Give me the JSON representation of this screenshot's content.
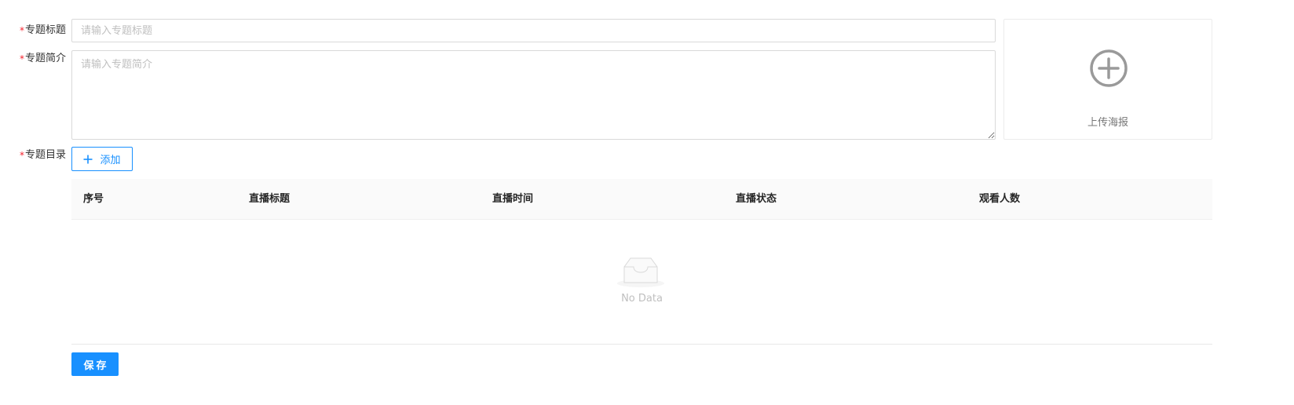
{
  "form": {
    "required_mark": "*",
    "title_label": "专题标题",
    "title_placeholder": "请输入专题标题",
    "title_value": "",
    "desc_label": "专题简介",
    "desc_placeholder": "请输入专题简介",
    "desc_value": "",
    "catalog_label": "专题目录",
    "add_label": "添加",
    "save_label": "保存"
  },
  "poster": {
    "upload_label": "上传海报",
    "icon": "plus-circle-icon"
  },
  "table": {
    "columns": [
      "序号",
      "直播标题",
      "直播时间",
      "直播状态",
      "观看人数"
    ],
    "rows": [],
    "empty_text": "No Data"
  },
  "colors": {
    "primary": "#1890ff",
    "required": "#f5222d",
    "border": "#d9d9d9",
    "header_bg": "#fafafa",
    "placeholder": "#bfbfbf"
  }
}
